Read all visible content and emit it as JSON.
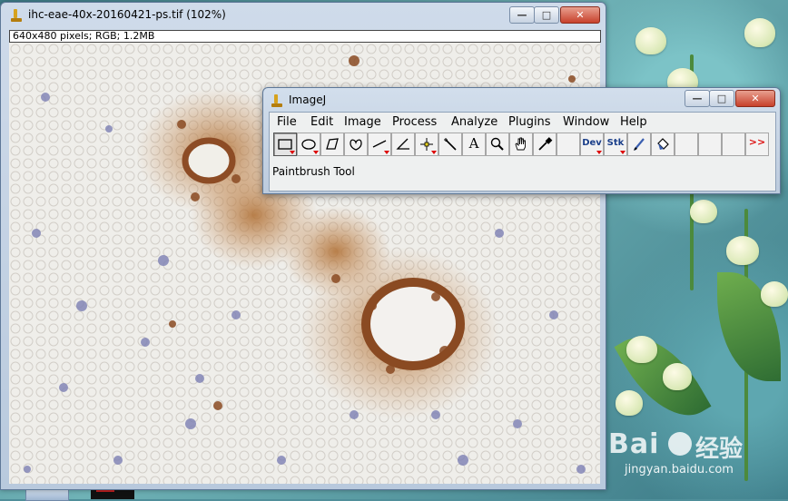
{
  "image_window": {
    "title": "ihc-eae-40x-20160421-ps.tif (102%)",
    "info": "640x480 pixels; RGB; 1.2MB",
    "buttons": {
      "minimize": "—",
      "maximize": "□",
      "close": "✕"
    }
  },
  "imagej_window": {
    "title": "ImageJ",
    "buttons": {
      "minimize": "—",
      "maximize": "□",
      "close": "✕"
    },
    "menus": [
      "File",
      "Edit",
      "Image",
      "Process",
      "Analyze",
      "Plugins",
      "Window",
      "Help"
    ],
    "tools": [
      {
        "name": "rectangle",
        "icon": "rectangle-icon",
        "active": true,
        "dropdown": true
      },
      {
        "name": "oval",
        "icon": "oval-icon",
        "dropdown": true
      },
      {
        "name": "polygon",
        "icon": "polygon-icon"
      },
      {
        "name": "freehand",
        "icon": "freehand-icon"
      },
      {
        "name": "line",
        "icon": "line-icon",
        "dropdown": true
      },
      {
        "name": "angle",
        "icon": "angle-icon"
      },
      {
        "name": "point",
        "icon": "point-icon",
        "dropdown": true
      },
      {
        "name": "wand",
        "icon": "wand-icon"
      },
      {
        "name": "text",
        "icon": "text-icon",
        "label": "A"
      },
      {
        "name": "magnifier",
        "icon": "magnifier-icon"
      },
      {
        "name": "hand",
        "icon": "hand-icon"
      },
      {
        "name": "dropper",
        "icon": "dropper-icon"
      },
      {
        "name": "empty-1",
        "icon": ""
      },
      {
        "name": "developer-menu",
        "icon": "dev-icon",
        "label": "Dev",
        "dropdown": true
      },
      {
        "name": "stack-menu",
        "icon": "stk-icon",
        "label": "Stk",
        "dropdown": true
      },
      {
        "name": "paintbrush",
        "icon": "paintbrush-icon"
      },
      {
        "name": "flood-fill",
        "icon": "flood-fill-icon"
      },
      {
        "name": "empty-2",
        "icon": ""
      },
      {
        "name": "empty-3",
        "icon": ""
      },
      {
        "name": "empty-4",
        "icon": ""
      },
      {
        "name": "more-tools",
        "icon": "more-tools-icon",
        "label": ">>"
      }
    ],
    "status": "Paintbrush Tool"
  },
  "watermark": {
    "logo": "Bai",
    "text_cn": "经验",
    "url": "jingyan.baidu.com"
  },
  "colors": {
    "accent_red": "#d11111",
    "stain_brown": "#9a5a2a",
    "nuclei_blue": "#7d80b4"
  }
}
